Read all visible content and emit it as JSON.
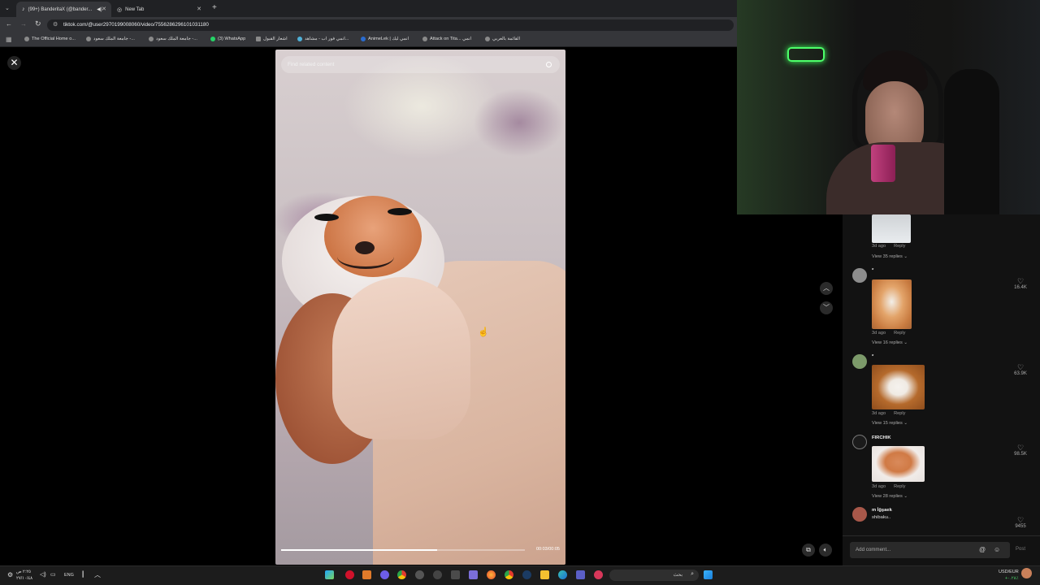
{
  "tabs": [
    {
      "label": "(99+) BanderitaX (@bander...",
      "active": true
    },
    {
      "label": "New Tab",
      "active": false
    }
  ],
  "address": "tiktok.com/@user2970199008060/video/7556286296101031180",
  "bookmarks": [
    "The Official Home o...",
    "جامعة الملك سعود -...",
    "جامعة الملك سعود -...",
    "(3) WhatsApp",
    "اشعار القبول",
    "انمي فور اب - مشاهد...",
    "AnimeLek | انمي ليك",
    "Attack on Tita... انمي",
    "القائمة بالعربي"
  ],
  "video": {
    "search_placeholder": "Find related content",
    "timecode": "00:03/00:05",
    "progress": 0.64
  },
  "comments": [
    {
      "meta_time": "3d ago",
      "reply": "Reply",
      "view_replies": "View 35 replies ⌄"
    },
    {
      "name": "*",
      "meta_time": "3d ago",
      "reply": "Reply",
      "view_replies": "View 16 replies ⌄",
      "likes": "16.4K"
    },
    {
      "name": "*",
      "meta_time": "3d ago",
      "reply": "Reply",
      "view_replies": "View 15 replies ⌄",
      "likes": "63.9K"
    },
    {
      "name": "FIRCHIK",
      "meta_time": "3d ago",
      "reply": "Reply",
      "view_replies": "View 28 replies ⌄",
      "likes": "98.5K"
    },
    {
      "name": "m İğşaek",
      "text": "shibaku..",
      "likes": "9455"
    }
  ],
  "add_comment_placeholder": "Add comment...",
  "post_label": "Post",
  "taskbar": {
    "lang": "ENG",
    "clock_time": "٢:٢٥ ص",
    "clock_date": "٢٧/١٠/٤٨",
    "search_placeholder": "بحث",
    "currency": "USD/EUR",
    "currency_change": "+٠.٢٨٪"
  },
  "colors": {
    "tiktok_bg": "#121212",
    "chrome_dark": "#202124",
    "chrome_mid": "#35363a"
  }
}
